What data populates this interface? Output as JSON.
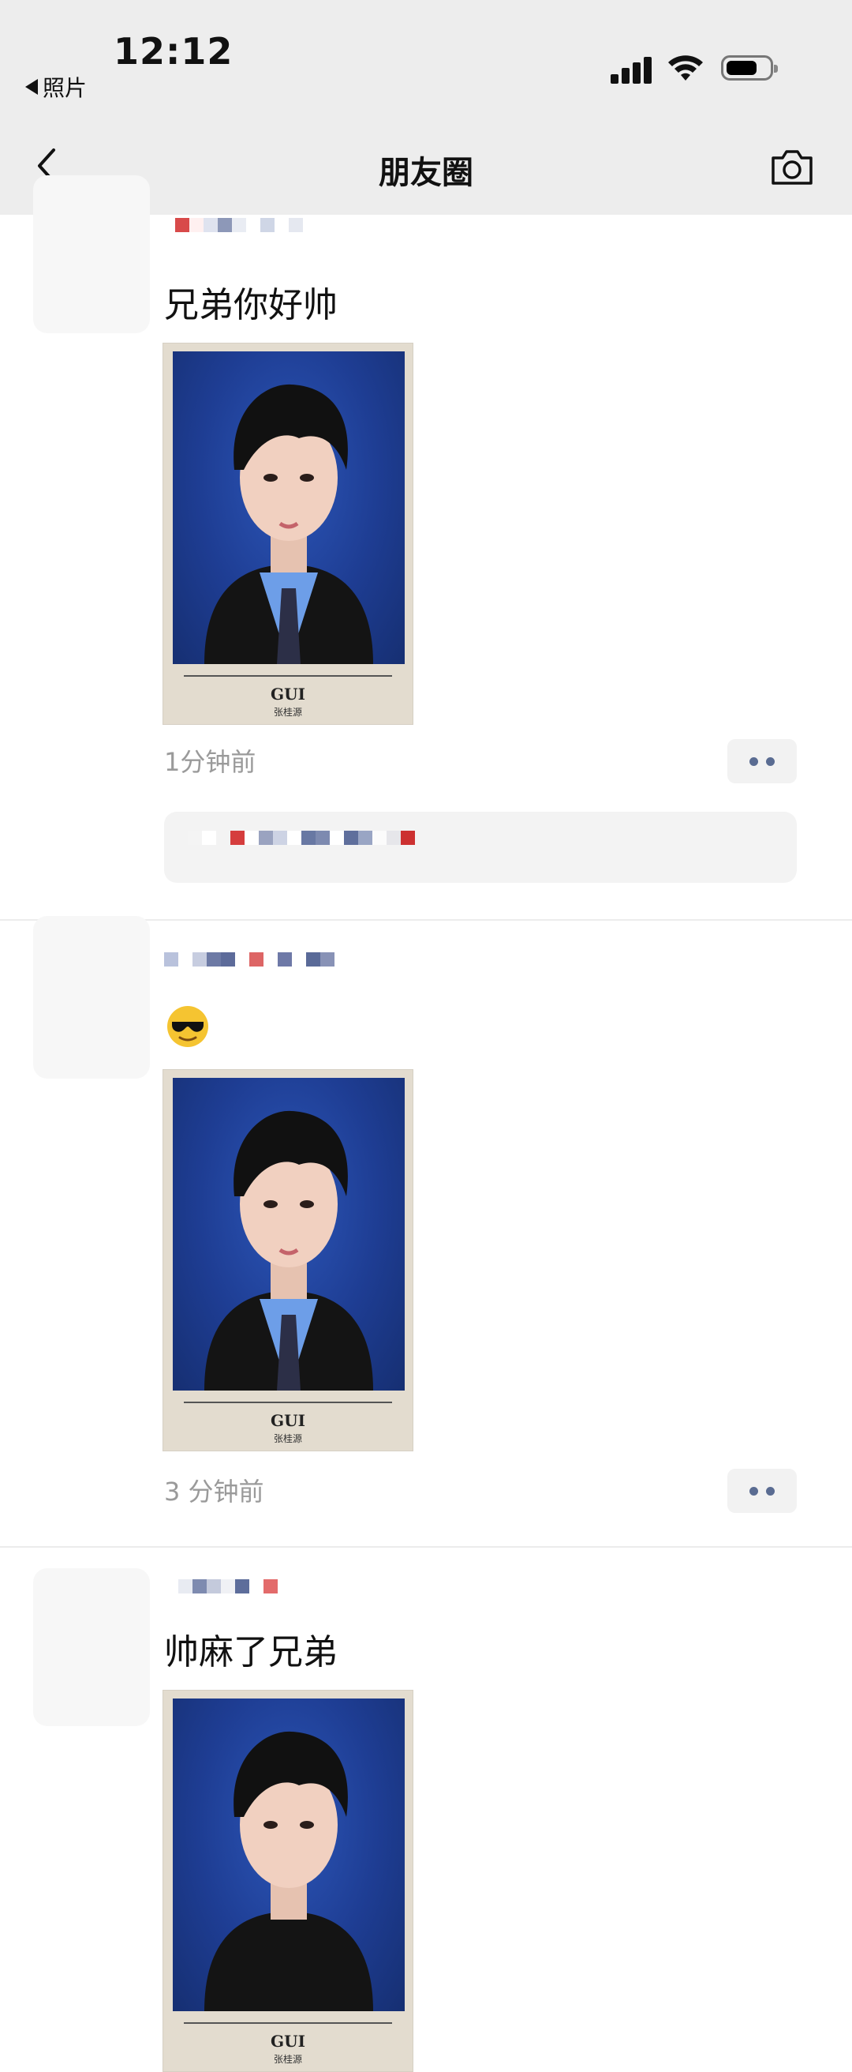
{
  "status_bar": {
    "back_app_label": "照片",
    "time": "12:12",
    "icons": [
      "cellular-signal-icon",
      "wifi-icon",
      "battery-icon"
    ]
  },
  "nav": {
    "title": "朋友圈",
    "back_icon": "chevron-left-icon",
    "camera_icon": "camera-icon"
  },
  "posts": [
    {
      "text": "兄弟你好帅",
      "photo": {
        "caption_title": "GUI",
        "caption_sub": "张桂源"
      },
      "timestamp": "1分钟前",
      "has_comment": true
    },
    {
      "text": "😎",
      "photo": {
        "caption_title": "GUI",
        "caption_sub": "张桂源"
      },
      "timestamp": "3 分钟前",
      "has_comment": false
    },
    {
      "text": "帅麻了兄弟",
      "photo": {
        "caption_title": "GUI",
        "caption_sub": "张桂源"
      }
    }
  ],
  "colors": {
    "header_bg": "#ededed",
    "link_blue": "#5a6c92",
    "timestamp_gray": "#9a9a9a",
    "photo_bg_blue": "#1e3d93"
  }
}
